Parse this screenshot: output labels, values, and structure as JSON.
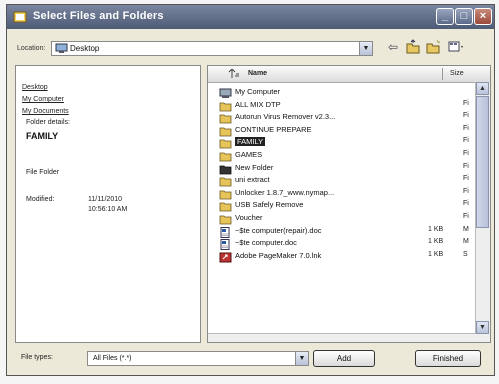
{
  "window": {
    "title": "Select Files and Folders",
    "controls": [
      "_",
      "□",
      "×"
    ]
  },
  "location": {
    "label": "Location:",
    "value": "Desktop"
  },
  "toolbar": {
    "icons": [
      "back-icon",
      "up-folder-icon",
      "new-folder-icon",
      "view-menu-icon"
    ]
  },
  "left_pane": {
    "links": [
      "Desktop",
      "My Computer",
      "My Documents"
    ],
    "details_heading": "Folder details:",
    "selected_name": "FAMILY",
    "type": "File Folder",
    "modified_label": "Modified:",
    "modified_date": "11/11/2010",
    "modified_time": "10:56:10 AM"
  },
  "list": {
    "columns": {
      "name": "Name",
      "size": "Size"
    },
    "rows": [
      {
        "name": "My Computer",
        "size": "",
        "type": "",
        "icon": "computer-icon"
      },
      {
        "name": "ALL MIX DTP",
        "size": "",
        "type": "Fi",
        "icon": "folder-icon"
      },
      {
        "name": "Autorun Virus Remover v2.3...",
        "size": "",
        "type": "Fi",
        "icon": "folder-icon"
      },
      {
        "name": "CONTINUE PREPARE",
        "size": "",
        "type": "Fi",
        "icon": "folder-icon"
      },
      {
        "name": "FAMILY",
        "size": "",
        "type": "Fi",
        "icon": "folder-icon",
        "selected": true
      },
      {
        "name": "GAMES",
        "size": "",
        "type": "Fi",
        "icon": "folder-icon"
      },
      {
        "name": "New Folder",
        "size": "",
        "type": "Fi",
        "icon": "folder-dark-icon"
      },
      {
        "name": "uni extract",
        "size": "",
        "type": "Fi",
        "icon": "folder-icon"
      },
      {
        "name": "Unlocker 1.8.7_www.nymap...",
        "size": "",
        "type": "Fi",
        "icon": "folder-icon"
      },
      {
        "name": "USB Safely Remove",
        "size": "",
        "type": "Fi",
        "icon": "folder-icon"
      },
      {
        "name": "Voucher",
        "size": "",
        "type": "Fi",
        "icon": "folder-icon"
      },
      {
        "name": "~$te computer(repair).doc",
        "size": "1 KB",
        "type": "M",
        "icon": "doc-icon"
      },
      {
        "name": "~$te computer.doc",
        "size": "1 KB",
        "type": "M",
        "icon": "doc-icon"
      },
      {
        "name": "Adobe PageMaker 7.0.lnk",
        "size": "1 KB",
        "type": "S",
        "icon": "shortcut-icon"
      }
    ]
  },
  "filetypes": {
    "label": "File types:",
    "value": "All Files (*.*)"
  },
  "buttons": {
    "add": "Add",
    "finished": "Finished"
  }
}
